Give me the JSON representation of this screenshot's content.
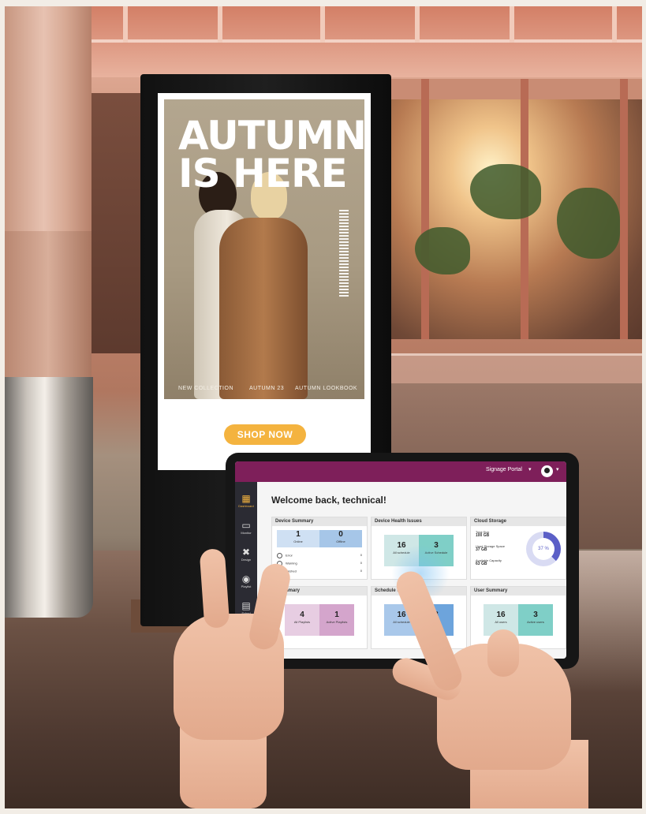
{
  "poster": {
    "headline_line1": "AUTUMN",
    "headline_line2": "IS HERE",
    "footer_left": "NEW COLLECTION",
    "footer_mid": "AUTUMN 23",
    "footer_right": "AUTUMN LOOKBOOK",
    "cta_label": "SHOP NOW",
    "cta_color": "#f4b33f"
  },
  "tablet_app": {
    "topbar": {
      "portal_label": "Signage Portal",
      "caret": "▾",
      "bar_color": "#7e1f5a"
    },
    "sidebar": {
      "items": [
        {
          "icon": "dashboard-icon",
          "glyph": "▦",
          "label": "Dashboard"
        },
        {
          "icon": "monitor-icon",
          "glyph": "▭",
          "label": "Monitor"
        },
        {
          "icon": "design-icon",
          "glyph": "✖",
          "label": "Design"
        },
        {
          "icon": "playlist-icon",
          "glyph": "◉",
          "label": "Playlist"
        },
        {
          "icon": "schedule-icon",
          "glyph": "▤",
          "label": "Sched"
        }
      ]
    },
    "welcome": "Welcome back, technical!",
    "device_summary": {
      "title": "Device Summary",
      "online_value": "1",
      "online_label": "Online",
      "offline_value": "0",
      "offline_label": "Offline",
      "rows": [
        {
          "label": "Error",
          "count": "0"
        },
        {
          "label": "Warning",
          "count": "0"
        },
        {
          "label": "finished",
          "count": "0"
        }
      ]
    },
    "device_health": {
      "title": "Device Health Issues",
      "a_value": "16",
      "a_label": "All schedule",
      "b_value": "3",
      "b_label": "Active Schedule"
    },
    "cloud_storage": {
      "title": "Cloud Storage",
      "total_label": "Total Size",
      "total_value": "100 GB",
      "used_label": "Used Storage Space",
      "used_value": "37 GB",
      "avail_label": "Available Capacity",
      "avail_value": "63 GB",
      "percent_label": "37 %",
      "percent": 37,
      "accent": "#5b5fc7"
    },
    "playlist_summary": {
      "title": "t Summary",
      "a_value": "4",
      "a_label": "All Playlists",
      "b_value": "1",
      "b_label": "Active Playlists"
    },
    "schedule_summary": {
      "title": "Schedule Summar",
      "a_value": "16",
      "a_label": "All schedule",
      "b_value": "3",
      "b_label": "Ac"
    },
    "user_summary": {
      "title": "User Summary",
      "a_value": "16",
      "a_label": "All users",
      "b_value": "3",
      "b_label": "Active users"
    }
  }
}
